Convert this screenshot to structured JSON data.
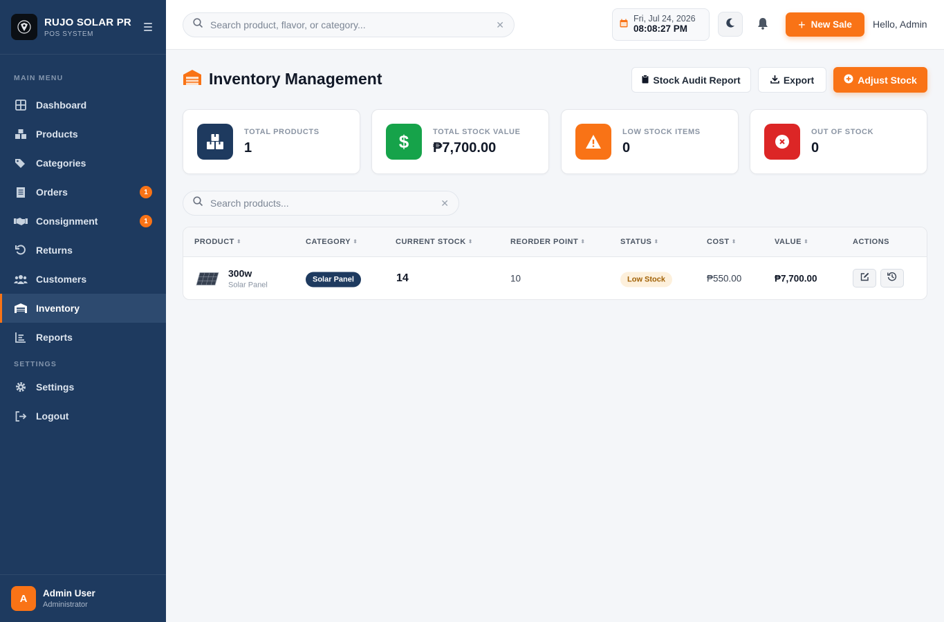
{
  "brand": {
    "name": "RUJO SOLAR PRO",
    "subtitle": "POS SYSTEM",
    "logo_icon": "dragon-logo-icon"
  },
  "sidebar": {
    "main_section": "MAIN MENU",
    "settings_section": "SETTINGS",
    "items": [
      {
        "label": "Dashboard",
        "icon": "grid-icon"
      },
      {
        "label": "Products",
        "icon": "boxes-icon"
      },
      {
        "label": "Categories",
        "icon": "tags-icon"
      },
      {
        "label": "Orders",
        "icon": "receipt-icon",
        "badge": "1"
      },
      {
        "label": "Consignment",
        "icon": "handshake-icon",
        "badge": "1"
      },
      {
        "label": "Returns",
        "icon": "undo-icon"
      },
      {
        "label": "Customers",
        "icon": "users-icon"
      },
      {
        "label": "Inventory",
        "icon": "warehouse-icon",
        "active": true
      },
      {
        "label": "Reports",
        "icon": "chart-icon"
      }
    ],
    "settings_items": [
      {
        "label": "Settings",
        "icon": "gear-icon"
      },
      {
        "label": "Logout",
        "icon": "logout-icon"
      }
    ],
    "user": {
      "initial": "A",
      "name": "Admin User",
      "role": "Administrator"
    }
  },
  "topbar": {
    "search_placeholder": "Search product, flavor, or category...",
    "date": "Fri, Jul 24, 2026",
    "time": "08:08:27 PM",
    "new_sale_label": "New Sale",
    "greeting": "Hello, Admin"
  },
  "page": {
    "title": "Inventory Management",
    "buttons": {
      "audit": "Stock Audit Report",
      "export": "Export",
      "adjust": "Adjust Stock"
    }
  },
  "stats": [
    {
      "label": "TOTAL PRODUCTS",
      "value": "1",
      "color": "#1e3a5f"
    },
    {
      "label": "TOTAL STOCK VALUE",
      "value": "₱7,700.00",
      "color": "#16a34a"
    },
    {
      "label": "LOW STOCK ITEMS",
      "value": "0",
      "color": "#f97316"
    },
    {
      "label": "OUT OF STOCK",
      "value": "0",
      "color": "#dc2626"
    }
  ],
  "product_search": {
    "placeholder": "Search products..."
  },
  "table": {
    "headers": [
      "PRODUCT",
      "CATEGORY",
      "CURRENT STOCK",
      "REORDER POINT",
      "STATUS",
      "COST",
      "VALUE",
      "ACTIONS"
    ],
    "rows": [
      {
        "name": "300w",
        "sub": "Solar Panel",
        "category": "Solar Panel",
        "stock": "14",
        "reorder": "10",
        "status": "Low Stock",
        "cost": "₱550.00",
        "value": "₱7,700.00"
      }
    ]
  }
}
